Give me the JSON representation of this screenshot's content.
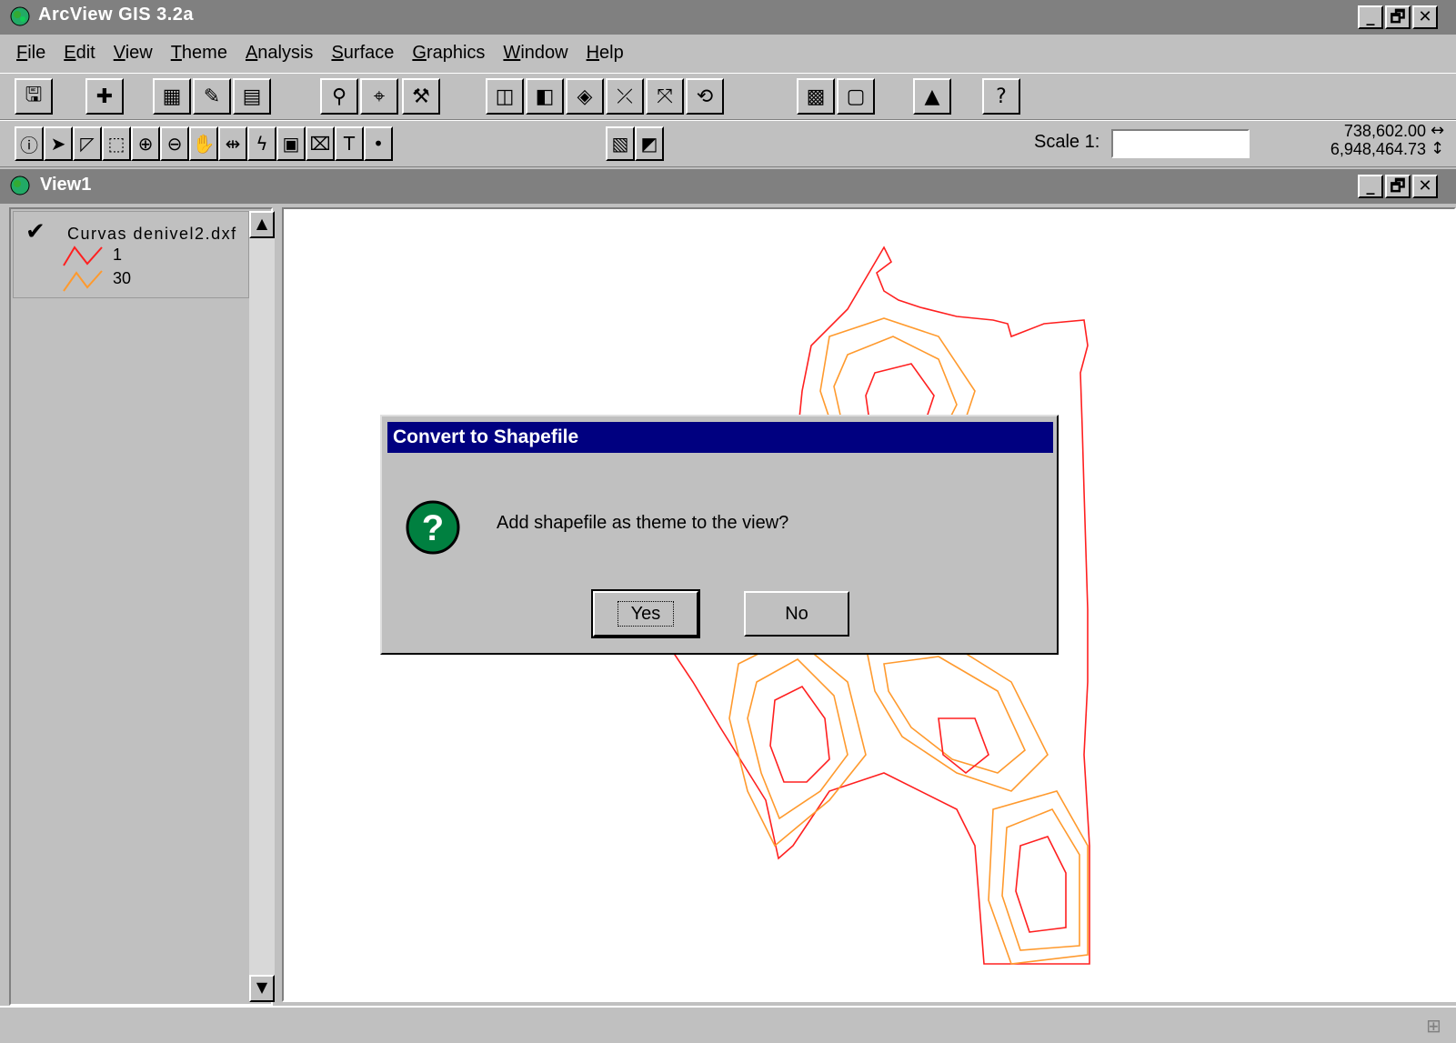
{
  "app": {
    "title": "ArcView GIS 3.2a",
    "window_buttons": [
      "_",
      "🗗",
      "✕"
    ]
  },
  "menu": [
    {
      "label": "File",
      "ul": "F",
      "rest": "ile"
    },
    {
      "label": "Edit",
      "ul": "E",
      "rest": "dit"
    },
    {
      "label": "View",
      "ul": "V",
      "rest": "iew"
    },
    {
      "label": "Theme",
      "ul": "T",
      "rest": "heme"
    },
    {
      "label": "Analysis",
      "ul": "A",
      "rest": "nalysis"
    },
    {
      "label": "Surface",
      "ul": "S",
      "rest": "urface"
    },
    {
      "label": "Graphics",
      "ul": "G",
      "rest": "raphics"
    },
    {
      "label": "Window",
      "ul": "W",
      "rest": "indow"
    },
    {
      "label": "Help",
      "ul": "H",
      "rest": "elp"
    }
  ],
  "toolbar": {
    "buttons": [
      "save-icon",
      "add-theme-icon",
      "theme-properties-icon",
      "edit-legend-icon",
      "open-table-icon",
      "find-icon",
      "locate-address-icon",
      "query-builder-icon",
      "zoom-full-extent-icon",
      "zoom-active-themes-icon",
      "zoom-selected-icon",
      "zoom-in-fixed-icon",
      "zoom-out-fixed-icon",
      "zoom-previous-icon",
      "select-by-theme-icon",
      "clear-selected-icon",
      "create-chart-icon",
      "help-cursor-icon"
    ]
  },
  "tools": {
    "buttons": [
      "identify-icon",
      "pointer-icon",
      "vertex-edit-icon",
      "select-feature-icon",
      "zoom-in-icon",
      "zoom-out-icon",
      "pan-icon",
      "measure-icon",
      "hotlink-icon",
      "area-of-interest-icon",
      "label-icon",
      "text-icon",
      "draw-point-icon",
      "contour-icon",
      "hillshade-icon"
    ]
  },
  "scale": {
    "label": "Scale 1:",
    "value": ""
  },
  "coords": {
    "x": "738,602.00",
    "y": "6,948,464.73",
    "x_arrow": "↔",
    "y_arrow": "↕"
  },
  "view": {
    "title": "View1"
  },
  "toc": {
    "theme_name": "Curvas denivel2.dxf",
    "legend": [
      {
        "label": "1",
        "color": "#ff2020"
      },
      {
        "label": "30",
        "color": "#ff9a2e"
      }
    ]
  },
  "dialog": {
    "title": "Convert to Shapefile",
    "message": "Add shapefile as theme to the view?",
    "yes": "Yes",
    "no": "No",
    "icon_color": "#008040"
  }
}
